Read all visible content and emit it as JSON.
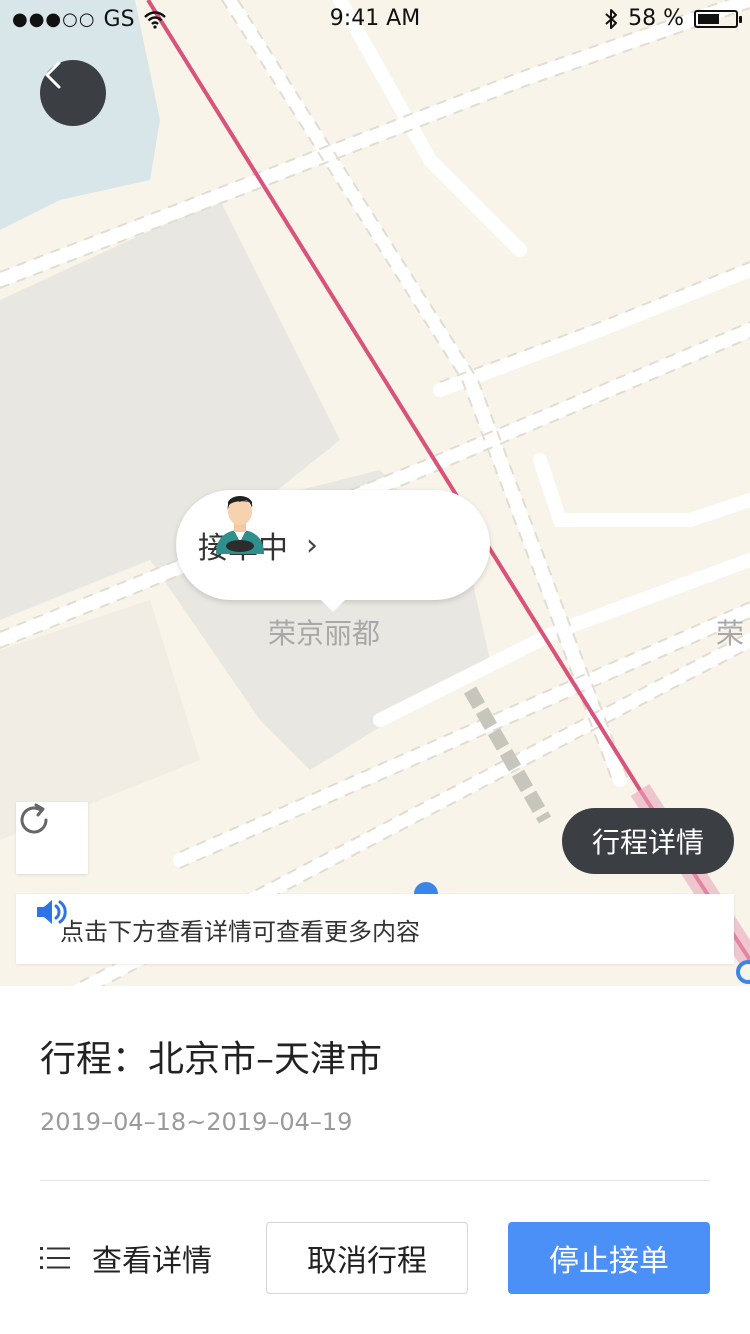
{
  "status_bar": {
    "signal_dots": "●●●○○",
    "carrier": "GS",
    "time": "9:41 AM",
    "battery_percent": "58 %",
    "battery_level": 0.58
  },
  "map": {
    "status_bubble": {
      "label": "接单中",
      "chevron": "›"
    },
    "poi_label": "荣京丽都",
    "road_label": "荣",
    "trip_detail_button": "行程详情",
    "notice_text": "点击下方查看详情可查看更多内容",
    "icons": [
      "back-icon",
      "driver-avatar-icon",
      "refresh-icon",
      "speaker-icon"
    ]
  },
  "panel": {
    "route_title": "行程：北京市–天津市",
    "date_range": "2019–04–18~2019–04–19",
    "view_detail_label": "查看详情",
    "cancel_label": "取消行程",
    "stop_label": "停止接单"
  },
  "colors": {
    "accent": "#4a90f7",
    "rail_line": "#d9527a",
    "dark_button": "#3b3f44"
  }
}
